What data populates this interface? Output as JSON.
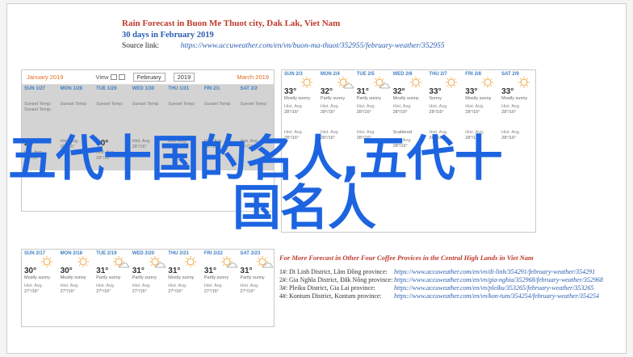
{
  "header": {
    "title": "Rain Forecast in Buon Me Thuot city, Dak Lak, Viet Nam",
    "subtitle": "30 days in February 2019",
    "source_label": "Source link:",
    "source_url": "https://www.accuweather.com/en/vn/buon-ma-thuot/352955/february-weather/352955"
  },
  "calendar_nav": {
    "prev_label": "January 2019",
    "view_label": "View",
    "month": "February",
    "year": "2019",
    "next_label": "March 2019"
  },
  "panel1": {
    "days": [
      {
        "name": "SUN 1/27",
        "desc": "Sunset Temp:",
        "desc2": "Sunset Temp:",
        "temp": "",
        "avg": "",
        "avg2": ""
      },
      {
        "name": "MON 1/28",
        "desc": "Sunset Temp:",
        "desc2": "",
        "temp": "",
        "avg": "",
        "avg2": ""
      },
      {
        "name": "TUE 1/29",
        "desc": "Sunset Temp:",
        "desc2": "",
        "temp": "",
        "avg": "",
        "avg2": ""
      },
      {
        "name": "WED 1/30",
        "desc": "Sunset Temp:",
        "desc2": "",
        "temp": "",
        "avg": "",
        "avg2": ""
      },
      {
        "name": "THU 1/31",
        "desc": "Sunset Temp:",
        "desc2": "",
        "temp": "",
        "avg": "",
        "avg2": ""
      },
      {
        "name": "FRI 2/1",
        "desc": "Sunset Temp:",
        "desc2": "",
        "temp": "",
        "avg": "",
        "avg2": ""
      },
      {
        "name": "SAT 2/2",
        "desc": "Sunset Temp:",
        "desc2": "",
        "temp": "",
        "avg": "",
        "avg2": ""
      },
      {
        "name": "",
        "desc": "",
        "desc2": "",
        "temp": "29°",
        "avg": "Hist. Avg.",
        "avg2": "28°/16°"
      },
      {
        "name": "",
        "desc": "",
        "desc2": "",
        "temp": "",
        "avg": "Hist. Avg.",
        "avg2": "28°/16°"
      },
      {
        "name": "",
        "desc": "",
        "desc2": "",
        "temp": "30°",
        "avg": "Hist. Avg.",
        "avg2": "28°/16°"
      },
      {
        "name": "",
        "desc": "",
        "desc2": "",
        "temp": "",
        "avg": "Hist. Avg.",
        "avg2": "28°/16°"
      },
      {
        "name": "",
        "desc": "",
        "desc2": "",
        "temp": "",
        "avg": "Hist. Avg.",
        "avg2": "28°/16°"
      },
      {
        "name": "",
        "desc": "",
        "desc2": "",
        "temp": "",
        "avg": "Hist. Avg.",
        "avg2": "28°/16°"
      },
      {
        "name": "",
        "desc": "",
        "desc2": "",
        "temp": "",
        "avg": "Hist. Avg.",
        "avg2": "28°/16°"
      }
    ]
  },
  "panel2": {
    "days": [
      {
        "name": "SUN 2/3",
        "temp": "33°",
        "desc": "Mostly sunny",
        "avg": "Hist. Avg.",
        "avg2": "28°/16°"
      },
      {
        "name": "MON 2/4",
        "temp": "32°",
        "desc": "Partly sunny",
        "avg": "Hist. Avg.",
        "avg2": "28°/16°"
      },
      {
        "name": "TUE 2/5",
        "temp": "31°",
        "desc": "Partly sunny",
        "avg": "Hist. Avg.",
        "avg2": "28°/16°"
      },
      {
        "name": "WED 2/6",
        "temp": "32°",
        "desc": "Mostly sunny",
        "avg": "Hist. Avg.",
        "avg2": "28°/16°"
      },
      {
        "name": "THU 2/7",
        "temp": "33°",
        "desc": "Sunny",
        "avg": "Hist. Avg.",
        "avg2": "28°/16°"
      },
      {
        "name": "FRI 2/8",
        "temp": "33°",
        "desc": "Mostly sunny",
        "avg": "Hist. Avg.",
        "avg2": "28°/16°"
      },
      {
        "name": "SAT 2/9",
        "temp": "33°",
        "desc": "Mostly sunny",
        "avg": "Hist. Avg.",
        "avg2": "28°/16°"
      },
      {
        "name": "",
        "temp": "",
        "desc": "",
        "avg": "Hist. Avg.",
        "avg2": "28°/16°"
      },
      {
        "name": "",
        "temp": "",
        "desc": "",
        "avg": "Hist. Avg.",
        "avg2": "28°/16°"
      },
      {
        "name": "",
        "temp": "",
        "desc": "",
        "avg": "Hist. Avg.",
        "avg2": "28°/16°"
      },
      {
        "name": "",
        "temp": "",
        "desc": "Scattered",
        "avg": "Hist. Avg.",
        "avg2": "28°/16°"
      },
      {
        "name": "",
        "temp": "",
        "desc": "",
        "avg": "Hist. Avg.",
        "avg2": "28°/16°"
      },
      {
        "name": "",
        "temp": "",
        "desc": "",
        "avg": "Hist. Avg.",
        "avg2": "28°/16°"
      },
      {
        "name": "",
        "temp": "",
        "desc": "",
        "avg": "Hist. Avg.",
        "avg2": "28°/16°"
      }
    ]
  },
  "panel3": {
    "days": [
      {
        "name": "SUN 2/17",
        "temp": "30°",
        "desc": "Mostly sunny",
        "avg": "Hist. Avg.",
        "avg2": "27°/16°"
      },
      {
        "name": "MON 2/18",
        "temp": "30°",
        "desc": "Mostly sunny",
        "avg": "Hist. Avg.",
        "avg2": "27°/16°"
      },
      {
        "name": "TUE 2/19",
        "temp": "31°",
        "desc": "Partly sunny",
        "avg": "Hist. Avg.",
        "avg2": "27°/16°"
      },
      {
        "name": "WED 2/20",
        "temp": "31°",
        "desc": "Partly sunny",
        "avg": "Hist. Avg.",
        "avg2": "27°/16°"
      },
      {
        "name": "THU 2/21",
        "temp": "31°",
        "desc": "Mostly sunny",
        "avg": "Hist. Avg.",
        "avg2": "27°/16°"
      },
      {
        "name": "FRI 2/22",
        "temp": "31°",
        "desc": "Partly sunny",
        "avg": "Hist. Avg.",
        "avg2": "27°/16°"
      },
      {
        "name": "SAT 2/23",
        "temp": "31°",
        "desc": "Partly sunny",
        "avg": "Hist. Avg.",
        "avg2": "27°/16°"
      }
    ]
  },
  "watermark": {
    "line1": "五代十国的名人,五代十",
    "line2": "国名人"
  },
  "more_forecast": {
    "title": "For More Forecast in Other Four Coffee Provices in the Central High Lands in Viet Nam",
    "items": [
      {
        "num": "1#:",
        "place": "Di Linh District, Lâm Đồng province:",
        "url": "https://www.accuweather.com/en/vn/di-linh/354291/february-weather/354291"
      },
      {
        "num": "2#:",
        "place": "Gia Nghĩa District, Đắk Nông province:",
        "url": "https://www.accuweather.com/en/vn/gia-nghia/352968/february-weather/352968"
      },
      {
        "num": "3#:",
        "place": "Pleiku District, Gia Lai province:",
        "url": "https://www.accuweather.com/en/vn/pleiku/353265/february-weather/353265"
      },
      {
        "num": "4#:",
        "place": "Kontum District, Kontum province:",
        "url": "https://www.accuweather.com/en/vn/kon-tum/354254/february-weather/354254"
      }
    ]
  },
  "colors": {
    "title_red": "#c0392b",
    "link_blue": "#2a5db0",
    "day_blue": "#3f7ec3",
    "watermark_blue": "#1d64e0",
    "sun_orange": "#f3a13a"
  },
  "icons": [
    "sun-icon",
    "partly-sunny-icon"
  ]
}
